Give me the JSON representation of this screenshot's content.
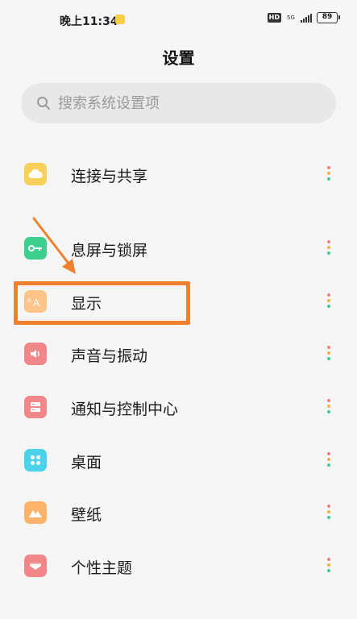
{
  "status_bar": {
    "time": "晚上11:34",
    "hd": "HD",
    "network": "5G",
    "battery": "89"
  },
  "header": {
    "title": "设置"
  },
  "search": {
    "placeholder": "搜索系统设置项",
    "icon": "search-icon"
  },
  "settings": {
    "items": [
      {
        "label": "连接与共享",
        "icon": "cloud-icon",
        "color": "#f9d15a"
      },
      {
        "label": "息屏与锁屏",
        "icon": "key-icon",
        "color": "#3ecf8e"
      },
      {
        "label": "显示",
        "icon": "font-size-icon",
        "color": "#ffc48a"
      },
      {
        "label": "声音与振动",
        "icon": "speaker-icon",
        "color": "#f2878a"
      },
      {
        "label": "通知与控制中心",
        "icon": "notification-icon",
        "color": "#f2878a"
      },
      {
        "label": "桌面",
        "icon": "grid-icon",
        "color": "#4cd2ea"
      },
      {
        "label": "壁纸",
        "icon": "mountain-icon",
        "color": "#ffb36b"
      },
      {
        "label": "个性主题",
        "icon": "theme-icon",
        "color": "#f2878a"
      }
    ]
  },
  "annotation": {
    "color": "#f07f2e"
  }
}
